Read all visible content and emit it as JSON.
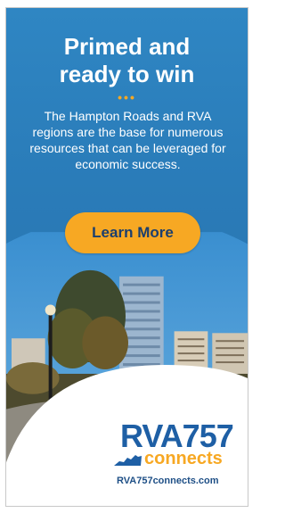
{
  "ad": {
    "headline_line1": "Primed and",
    "headline_line2": "ready to win",
    "dots": "•••",
    "body": "The Hampton Roads and RVA regions are the base for numerous resources that can be leveraged for economic success.",
    "cta_label": "Learn More",
    "logo_rva": "RVA757",
    "logo_connects": "connects",
    "site_url": "RVA757connects.com"
  },
  "colors": {
    "brand_blue": "#2a7dba",
    "accent_orange": "#f7a823",
    "logo_navy": "#1e5fa5"
  },
  "icons": {
    "state_shape": "virginia-state-icon"
  }
}
